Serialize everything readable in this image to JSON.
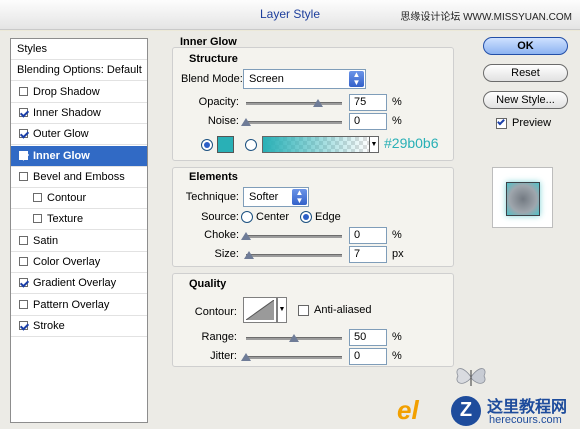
{
  "window": {
    "title": "Layer Style",
    "watermark_top": "思缘设计论坛  WWW.MISSYUAN.COM"
  },
  "sidebar": {
    "items": [
      {
        "label": "Styles",
        "type": "header"
      },
      {
        "label": "Blending Options: Default",
        "type": "header"
      },
      {
        "label": "Drop Shadow",
        "checked": false
      },
      {
        "label": "Inner Shadow",
        "checked": true
      },
      {
        "label": "Outer Glow",
        "checked": true
      },
      {
        "label": "Inner Glow",
        "checked": true,
        "selected": true
      },
      {
        "label": "Bevel and Emboss",
        "checked": false
      },
      {
        "label": "Contour",
        "checked": false,
        "indent": true
      },
      {
        "label": "Texture",
        "checked": false,
        "indent": true
      },
      {
        "label": "Satin",
        "checked": false
      },
      {
        "label": "Color Overlay",
        "checked": false
      },
      {
        "label": "Gradient Overlay",
        "checked": true
      },
      {
        "label": "Pattern Overlay",
        "checked": false
      },
      {
        "label": "Stroke",
        "checked": true
      }
    ]
  },
  "inner_glow": {
    "title": "Inner Glow",
    "structure": {
      "title": "Structure",
      "blend_mode_label": "Blend Mode:",
      "blend_mode_value": "Screen",
      "opacity_label": "Opacity:",
      "opacity_value": "75",
      "opacity_unit": "%",
      "opacity_level": 0.75,
      "noise_label": "Noise:",
      "noise_value": "0",
      "noise_unit": "%",
      "noise_level": 0,
      "color_hex": "#29b0b6",
      "color_label": "#29b0b6"
    },
    "elements": {
      "title": "Elements",
      "technique_label": "Technique:",
      "technique_value": "Softer",
      "source_label": "Source:",
      "source_center": "Center",
      "source_edge": "Edge",
      "choke_label": "Choke:",
      "choke_value": "0",
      "choke_unit": "%",
      "choke_level": 0,
      "size_label": "Size:",
      "size_value": "7",
      "size_unit": "px",
      "size_level": 0.03
    },
    "quality": {
      "title": "Quality",
      "contour_label": "Contour:",
      "anti_aliased_label": "Anti-aliased",
      "range_label": "Range:",
      "range_value": "50",
      "range_unit": "%",
      "range_level": 0.5,
      "jitter_label": "Jitter:",
      "jitter_value": "0",
      "jitter_unit": "%",
      "jitter_level": 0
    }
  },
  "buttons": {
    "ok": "OK",
    "reset": "Reset",
    "new_style": "New Style...",
    "preview_label": "Preview",
    "preview_checked": true
  },
  "watermark_bottom": {
    "logo_text": "el",
    "logo_z": "Z",
    "cn_text": "这里教程网",
    "site": "herecours.com"
  }
}
